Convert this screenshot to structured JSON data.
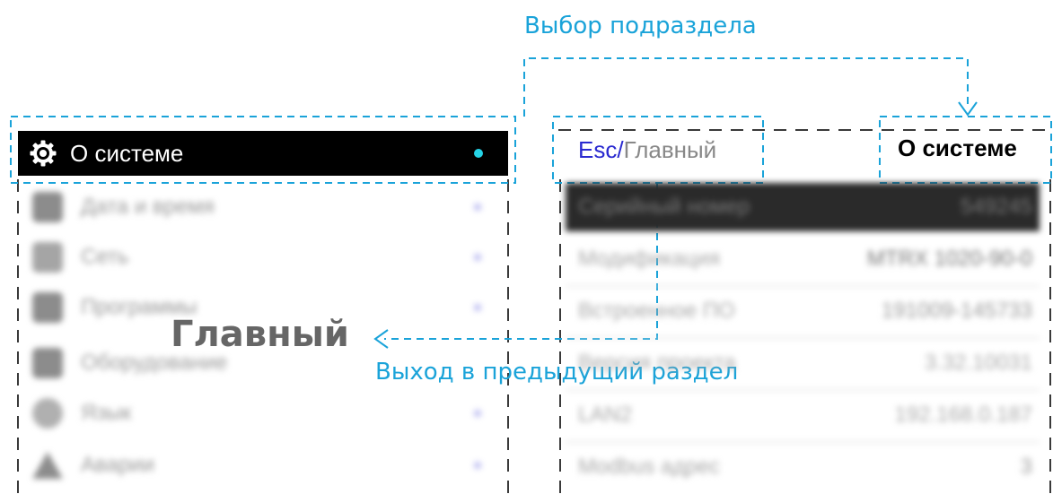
{
  "captions": {
    "select_subsection": "Выбор подраздела",
    "exit_previous": "Выход в предыдущий раздел",
    "main_big": "Главный"
  },
  "left_menu": {
    "selected_label": "О системе",
    "items": [
      {
        "label": "Дата и время",
        "icon": "calendar-icon"
      },
      {
        "label": "Сеть",
        "icon": "network-icon"
      },
      {
        "label": "Программы",
        "icon": "programs-icon"
      },
      {
        "label": "Оборудование",
        "icon": "hardware-icon"
      },
      {
        "label": "Язык",
        "icon": "globe-icon"
      },
      {
        "label": "Аварии",
        "icon": "warning-icon"
      }
    ]
  },
  "right_panel": {
    "header_esc": "Esc/",
    "header_back": "Главный",
    "header_title": "О системе",
    "rows": [
      {
        "key": "Серийный номер",
        "value": "549245"
      },
      {
        "key": "Модификация",
        "value": "MTRX 1020-90-0"
      },
      {
        "key": "Встроенное ПО",
        "value": "191009-145733"
      },
      {
        "key": "Версия проекта",
        "value": "3.32.10031"
      },
      {
        "key": "LAN2",
        "value": "192.168.0.187"
      },
      {
        "key": "Modbus адрес",
        "value": "3"
      }
    ]
  },
  "colors": {
    "accent": "#1aa3d9",
    "selected_bg": "#000000",
    "selected_dot": "#25d3e6",
    "esc_color": "#2a2ad0"
  }
}
